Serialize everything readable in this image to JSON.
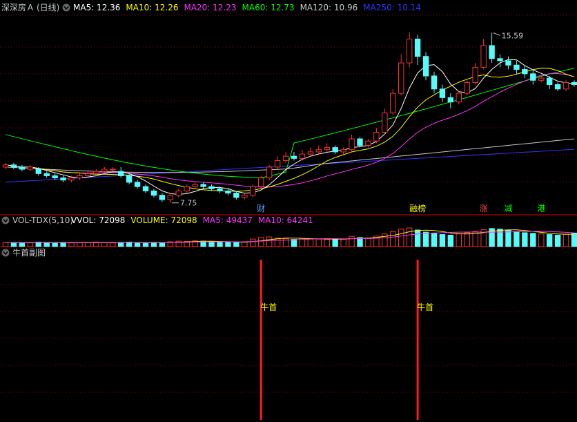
{
  "header": {
    "stock_name": "深深房Ａ",
    "period": "(日线)",
    "ma": [
      {
        "label": "MA5: 12.36",
        "color": "#ffffff"
      },
      {
        "label": "MA10: 12.26",
        "color": "#ffff00"
      },
      {
        "label": "MA20: 12.23",
        "color": "#ff33ff"
      },
      {
        "label": "MA60: 12.73",
        "color": "#00ff00"
      },
      {
        "label": "MA120: 10.96",
        "color": "#c8c8c8"
      },
      {
        "label": "MA250: 10.14",
        "color": "#3333ff"
      }
    ]
  },
  "volume_header": {
    "indicator": "VOL-TDX(5,10)",
    "items": [
      {
        "label": "VVOL: 72098",
        "color": "#ffffff"
      },
      {
        "label": "VOLUME: 72098",
        "color": "#ffff00"
      },
      {
        "label": "MA5: 49437",
        "color": "#ff33ff"
      },
      {
        "label": "MA10: 64241",
        "color": "#ff33ff"
      }
    ]
  },
  "sub_header": {
    "title": "牛首副图"
  },
  "colors": {
    "up": "#ff3232",
    "down": "#54fcfc",
    "grid": "#8b0000",
    "frame": "#b40000",
    "ma5": "#ffffff",
    "ma10": "#ffff00",
    "ma20": "#ff33ff",
    "ma60": "#00ff00",
    "ma120": "#c8c8c8",
    "ma250": "#3333ff"
  },
  "chart_data": {
    "type": "candlestick",
    "price_range": [
      7.2,
      16.4
    ],
    "annotations": [
      {
        "text": "15.59",
        "index": 59,
        "value": 15.59
      },
      {
        "text": "7.75",
        "index": 20,
        "value": 7.75
      }
    ],
    "event_markers": [
      {
        "text": "财",
        "index": 31,
        "color": "#5fa8ff"
      },
      {
        "text": "融榜",
        "index": 50,
        "color": "#ffff00"
      },
      {
        "text": "涨",
        "index": 58,
        "color": "#ff4444"
      },
      {
        "text": "减",
        "index": 61,
        "color": "#00ff00"
      },
      {
        "text": "港",
        "index": 65,
        "color": "#00ff00"
      }
    ],
    "candles": [
      [
        9.4,
        9.5,
        9.6,
        9.3
      ],
      [
        9.5,
        9.4,
        9.6,
        9.3
      ],
      [
        9.4,
        9.3,
        9.5,
        9.2
      ],
      [
        9.3,
        9.4,
        9.5,
        9.2
      ],
      [
        9.3,
        9.1,
        9.4,
        9.0
      ],
      [
        9.1,
        9.0,
        9.2,
        8.9
      ],
      [
        9.0,
        8.9,
        9.1,
        8.8
      ],
      [
        8.9,
        8.8,
        9.0,
        8.7
      ],
      [
        8.8,
        8.9,
        9.0,
        8.7
      ],
      [
        8.9,
        9.0,
        9.1,
        8.8
      ],
      [
        9.0,
        9.1,
        9.2,
        8.9
      ],
      [
        9.1,
        9.2,
        9.3,
        9.0
      ],
      [
        9.2,
        9.3,
        9.4,
        9.1
      ],
      [
        9.3,
        9.3,
        9.4,
        9.2
      ],
      [
        9.2,
        9.0,
        9.4,
        8.9
      ],
      [
        9.0,
        8.7,
        9.1,
        8.6
      ],
      [
        8.7,
        8.5,
        8.8,
        8.4
      ],
      [
        8.5,
        8.3,
        8.6,
        8.2
      ],
      [
        8.3,
        8.1,
        8.4,
        8.0
      ],
      [
        8.1,
        7.9,
        8.2,
        7.8
      ],
      [
        7.9,
        8.1,
        8.2,
        7.75
      ],
      [
        8.1,
        8.3,
        8.4,
        8.0
      ],
      [
        8.3,
        8.5,
        8.6,
        8.2
      ],
      [
        8.5,
        8.6,
        8.7,
        8.4
      ],
      [
        8.6,
        8.5,
        8.7,
        8.4
      ],
      [
        8.5,
        8.4,
        8.6,
        8.3
      ],
      [
        8.4,
        8.3,
        8.5,
        8.2
      ],
      [
        8.3,
        8.2,
        8.4,
        8.1
      ],
      [
        8.2,
        8.0,
        8.3,
        7.9
      ],
      [
        8.0,
        8.1,
        8.2,
        7.9
      ],
      [
        8.1,
        8.5,
        8.6,
        8.0
      ],
      [
        8.5,
        8.9,
        9.0,
        8.4
      ],
      [
        8.9,
        9.4,
        9.5,
        8.8
      ],
      [
        9.4,
        9.7,
        9.9,
        9.3
      ],
      [
        9.7,
        9.9,
        10.1,
        9.6
      ],
      [
        9.9,
        9.8,
        10.1,
        9.7
      ],
      [
        9.8,
        10.0,
        10.2,
        9.7
      ],
      [
        10.0,
        10.1,
        10.3,
        9.9
      ],
      [
        10.1,
        10.2,
        10.4,
        10.0
      ],
      [
        10.2,
        10.3,
        10.5,
        10.1
      ],
      [
        10.3,
        10.1,
        10.4,
        10.0
      ],
      [
        10.1,
        10.2,
        10.3,
        10.0
      ],
      [
        10.2,
        10.7,
        10.9,
        10.1
      ],
      [
        10.7,
        10.4,
        10.8,
        10.3
      ],
      [
        10.4,
        10.6,
        10.7,
        10.3
      ],
      [
        10.6,
        11.0,
        11.2,
        10.5
      ],
      [
        11.0,
        11.9,
        12.1,
        10.9
      ],
      [
        11.9,
        12.8,
        13.0,
        11.8
      ],
      [
        12.8,
        14.2,
        14.6,
        12.7
      ],
      [
        14.2,
        15.3,
        15.6,
        14.0
      ],
      [
        15.3,
        14.5,
        15.5,
        14.1
      ],
      [
        14.5,
        13.6,
        14.7,
        13.4
      ],
      [
        13.6,
        13.0,
        13.8,
        12.8
      ],
      [
        13.0,
        12.6,
        13.2,
        12.4
      ],
      [
        12.6,
        12.4,
        12.8,
        12.1
      ],
      [
        12.4,
        12.8,
        12.9,
        12.3
      ],
      [
        12.8,
        13.3,
        13.4,
        12.7
      ],
      [
        13.3,
        14.0,
        14.2,
        13.2
      ],
      [
        14.0,
        15.0,
        15.3,
        13.9
      ],
      [
        15.0,
        14.4,
        15.59,
        14.2
      ],
      [
        14.4,
        14.3,
        14.6,
        14.0
      ],
      [
        14.3,
        14.1,
        14.5,
        13.9
      ],
      [
        14.1,
        13.9,
        14.3,
        13.7
      ],
      [
        13.9,
        13.7,
        14.1,
        13.5
      ],
      [
        13.7,
        13.4,
        13.9,
        13.2
      ],
      [
        13.4,
        13.5,
        13.6,
        13.3
      ],
      [
        13.5,
        13.2,
        13.6,
        13.0
      ],
      [
        13.2,
        13.0,
        13.3,
        12.9
      ],
      [
        13.0,
        13.3,
        13.4,
        12.9
      ],
      [
        13.3,
        13.2,
        13.4,
        13.1
      ]
    ],
    "volume": [
      14,
      13,
      12,
      13,
      15,
      14,
      13,
      14,
      12,
      13,
      14,
      15,
      13,
      12,
      14,
      15,
      13,
      12,
      14,
      13,
      16,
      18,
      17,
      19,
      18,
      16,
      15,
      14,
      13,
      15,
      25,
      30,
      32,
      28,
      26,
      24,
      27,
      26,
      25,
      24,
      23,
      25,
      34,
      30,
      28,
      35,
      42,
      50,
      58,
      62,
      55,
      48,
      44,
      40,
      38,
      42,
      46,
      50,
      56,
      60,
      58,
      54,
      50,
      46,
      44,
      42,
      40,
      38,
      41,
      45
    ],
    "signals": [
      {
        "text": "牛首",
        "index": 31
      },
      {
        "text": "牛首",
        "index": 50
      }
    ]
  }
}
